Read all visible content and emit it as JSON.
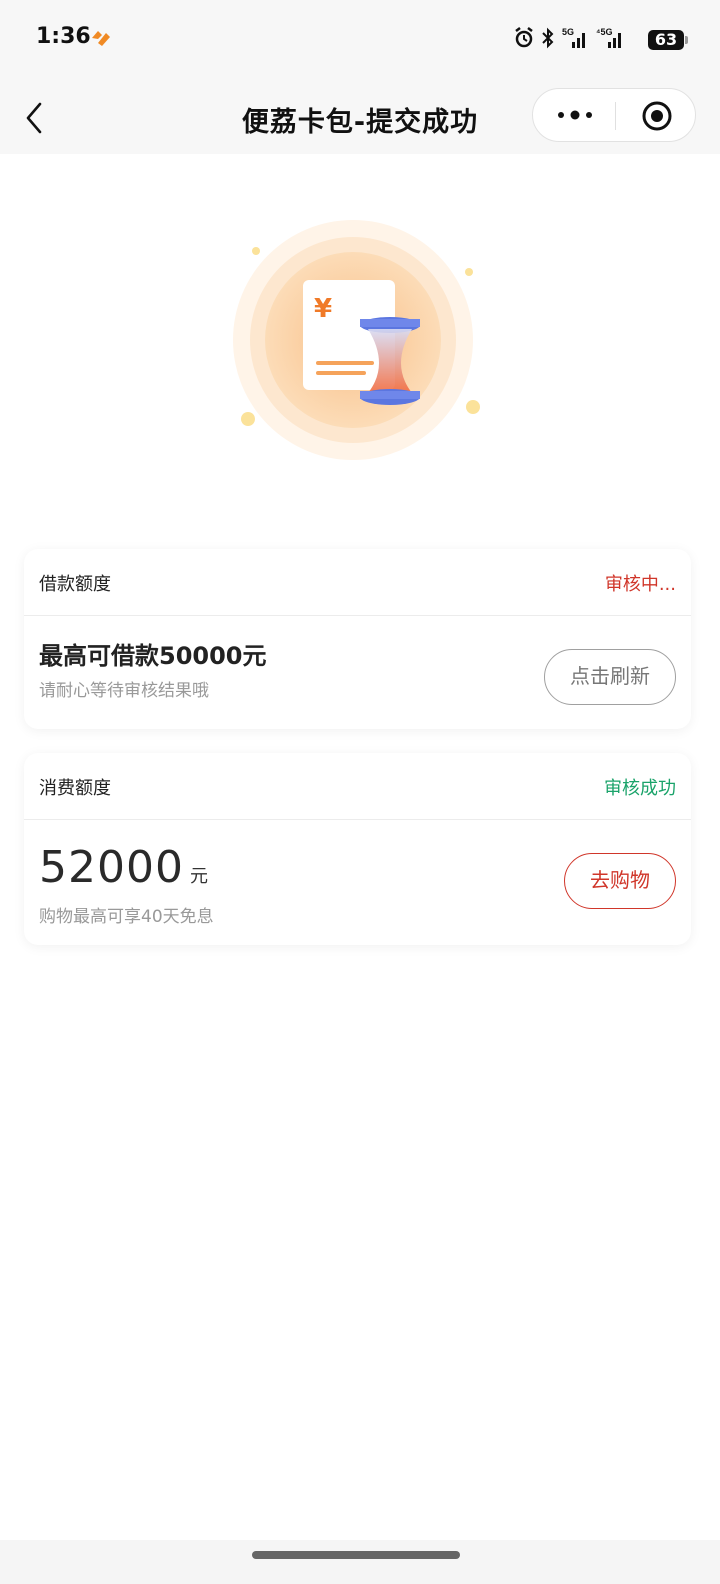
{
  "status_bar": {
    "time": "1:36",
    "battery": "63"
  },
  "nav": {
    "title": "便荔卡包-提交成功"
  },
  "loan_card": {
    "title": "借款额度",
    "status": "审核中...",
    "status_color": "#d0362a",
    "headline": "最高可借款50000元",
    "hint": "请耐心等待审核结果哦",
    "refresh_label": "点击刷新"
  },
  "consume_card": {
    "title": "消费额度",
    "status": "审核成功",
    "status_color": "#1aa36a",
    "amount": "52000",
    "unit": "元",
    "hint": "购物最高可享40天免息",
    "shop_label": "去购物"
  },
  "colors": {
    "accent": "#d0362a",
    "success": "#1aa36a",
    "hero_orange": "#f6a55a"
  }
}
